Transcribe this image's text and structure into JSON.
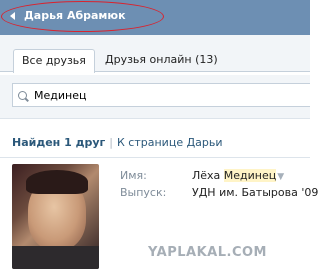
{
  "header": {
    "back_label": "Дарья Абрамюк",
    "back_icon": "chevron-left-icon"
  },
  "tabs": [
    {
      "label": "Все друзья",
      "active": true
    },
    {
      "label": "Друзья онлайн (13)",
      "active": false
    }
  ],
  "search": {
    "value": "Мединец",
    "icon": "search-icon"
  },
  "results": {
    "found": "Найден 1 друг",
    "separator": "|",
    "to_page": "К странице Дарьи"
  },
  "friend": {
    "name_label": "Имя:",
    "name_first": "Лёха ",
    "name_highlight": "Мединец",
    "name_arrow": "▼",
    "graduation_label": "Выпуск:",
    "graduation_value": "УДН им. Батырова '09"
  },
  "watermark": "YAPLAKAL.COM",
  "colors": {
    "header_bg": "#6d8fb3",
    "link": "#2b587a",
    "highlight": "#fff4c7",
    "annotation": "#d9232e"
  }
}
